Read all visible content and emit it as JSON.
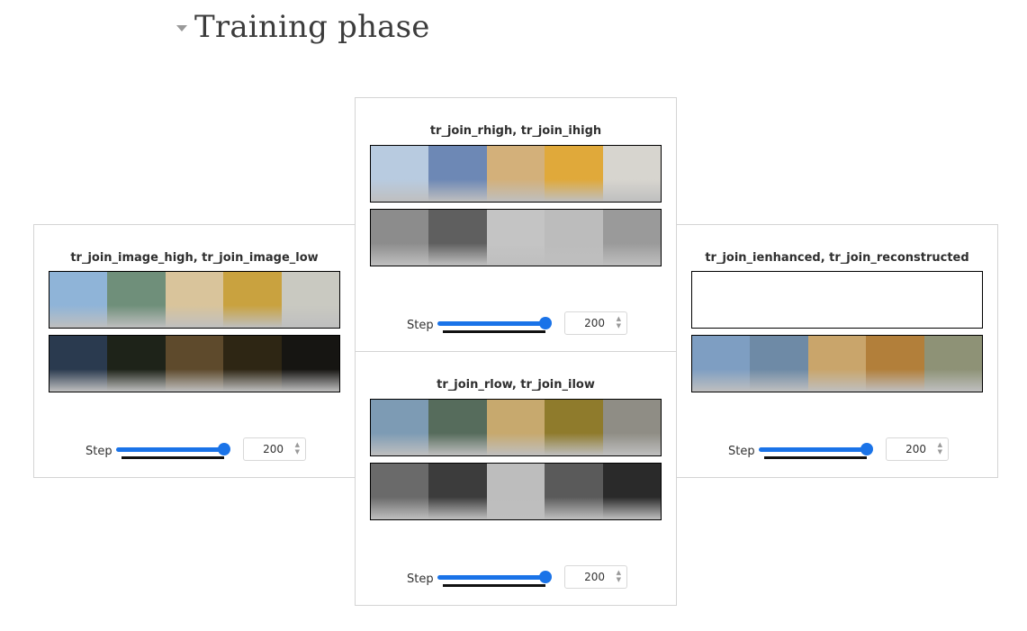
{
  "section": {
    "title": "Training phase",
    "expand_icon": "triangle-down-icon"
  },
  "cards": {
    "left": {
      "title": "tr_join_image_high, tr_join_image_low",
      "step_label": "Step",
      "step_value": "200",
      "slider_fraction": 1.0
    },
    "center_top": {
      "title": "tr_join_rhigh, tr_join_ihigh",
      "step_label": "Step",
      "step_value": "200",
      "slider_fraction": 1.0
    },
    "center_bottom": {
      "title": "tr_join_rlow, tr_join_ilow",
      "step_label": "Step",
      "step_value": "200",
      "slider_fraction": 1.0
    },
    "right": {
      "title": "tr_join_ienhanced, tr_join_reconstructed",
      "step_label": "Step",
      "step_value": "200",
      "slider_fraction": 1.0
    }
  },
  "palettes": {
    "high": [
      "#8fb4d8",
      "#6f8f7a",
      "#d9c49b",
      "#c9a23f",
      "#c9c9c1"
    ],
    "low": [
      "#2a3a4f",
      "#1e2319",
      "#5e4a2c",
      "#2e2614",
      "#161512"
    ],
    "rhigh": [
      "#b8cbe0",
      "#6d88b5",
      "#d3b07a",
      "#e0a93a",
      "#d7d5cf"
    ],
    "ihigh": [
      "#8c8c8c",
      "#5f5f5f",
      "#c4c4c4",
      "#bcbcbc",
      "#9a9a9a"
    ],
    "rlow": [
      "#7d9bb4",
      "#566c5c",
      "#c7a96e",
      "#8f7b2c",
      "#8f8d85"
    ],
    "ilow": [
      "#6a6a6a",
      "#3c3c3c",
      "#bdbdbd",
      "#5a5a5a",
      "#2a2a2a"
    ],
    "recon": [
      "#7e9ec2",
      "#6e8aa6",
      "#c9a56b",
      "#b27f3a",
      "#8e9276"
    ]
  }
}
